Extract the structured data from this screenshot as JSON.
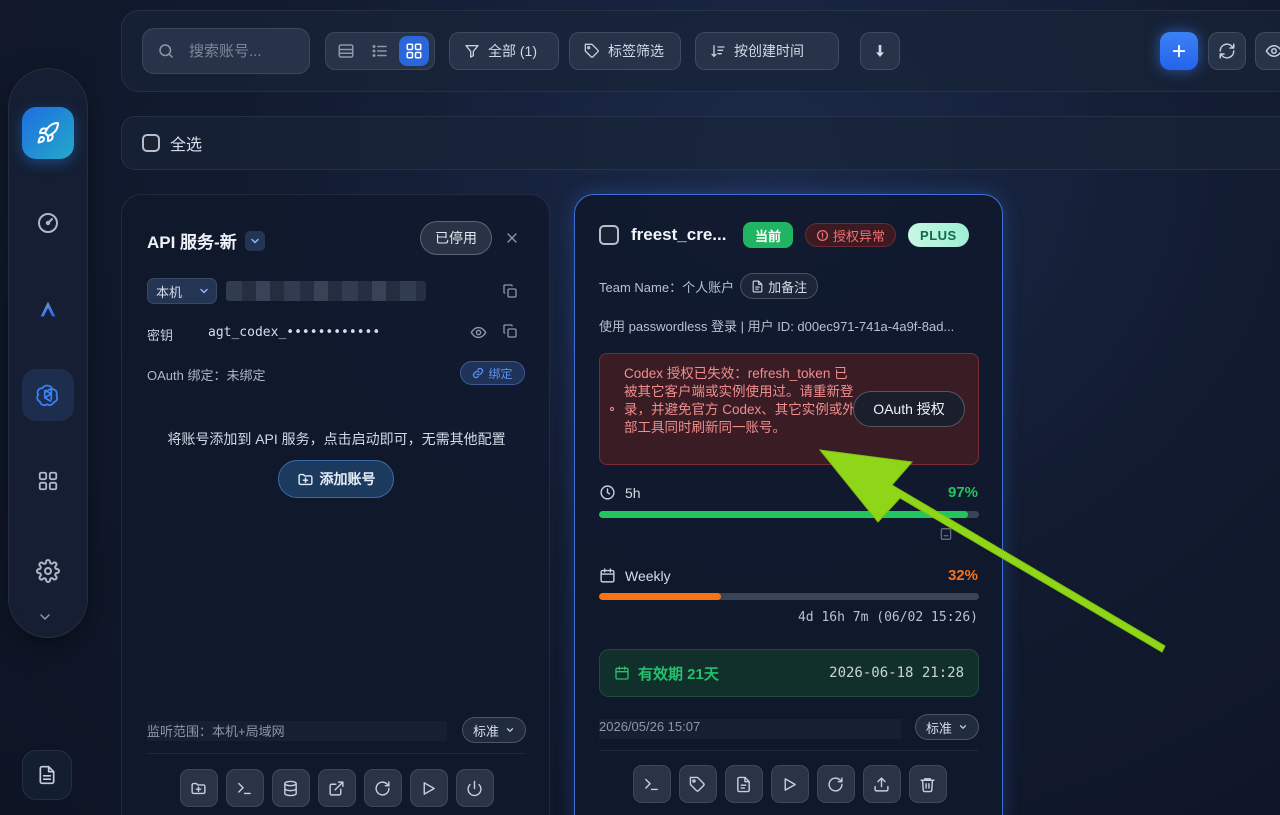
{
  "toolbar": {
    "search_placeholder": "搜索账号...",
    "filter_label": "全部 (1)",
    "tags_label": "标签筛选",
    "sort_label": "按创建时间"
  },
  "select_all": {
    "label": "全选"
  },
  "api_card": {
    "title": "API 服务-新",
    "status_button": "已停用",
    "host": "本机",
    "key_label": "密钥",
    "key_value": "agt_codex_••••••••••••",
    "oauth_label": "OAuth 绑定：未绑定",
    "bind_button": "绑定",
    "hint": "将账号添加到 API 服务，点击启动即可，无需其他配置",
    "add_account_button": "添加账号",
    "listen_scope": "监听范围：本机+局域网",
    "mode_select": "标准"
  },
  "account_card": {
    "name": "freest_cre...",
    "badges": {
      "current": "当前",
      "auth_error": "授权异常",
      "plan": "PLUS"
    },
    "team": "Team Name：个人账户",
    "note_button": "加备注",
    "login_info": "使用 passwordless 登录 | 用户 ID: d00ec971-741a-4a9f-8ad...",
    "alert_text": "Codex 授权已失效：refresh_token 已被其它客户端或实例使用过。请重新登录，并避免官方 Codex、其它实例或外部工具同时刷新同一账号。",
    "oauth_button": "OAuth 授权",
    "usage": [
      {
        "label": "5h",
        "percent_text": "97%",
        "percent": 97,
        "color": "#22c55e"
      },
      {
        "label": "Weekly",
        "percent_text": "32%",
        "percent": 32,
        "color": "#f97316"
      }
    ],
    "weekly_reset": "4d 16h 7m (06/02 15:26)",
    "expiry_label": "有效期 21天",
    "expiry_date": "2026-06-18 21:28",
    "created": "2026/05/26 15:07",
    "mode_select": "标准"
  },
  "colors": {
    "accent": "#2b67d8",
    "success": "#22c55e",
    "warning": "#f97316",
    "danger": "#f36f73",
    "annotation_arrow": "#8ed617"
  }
}
